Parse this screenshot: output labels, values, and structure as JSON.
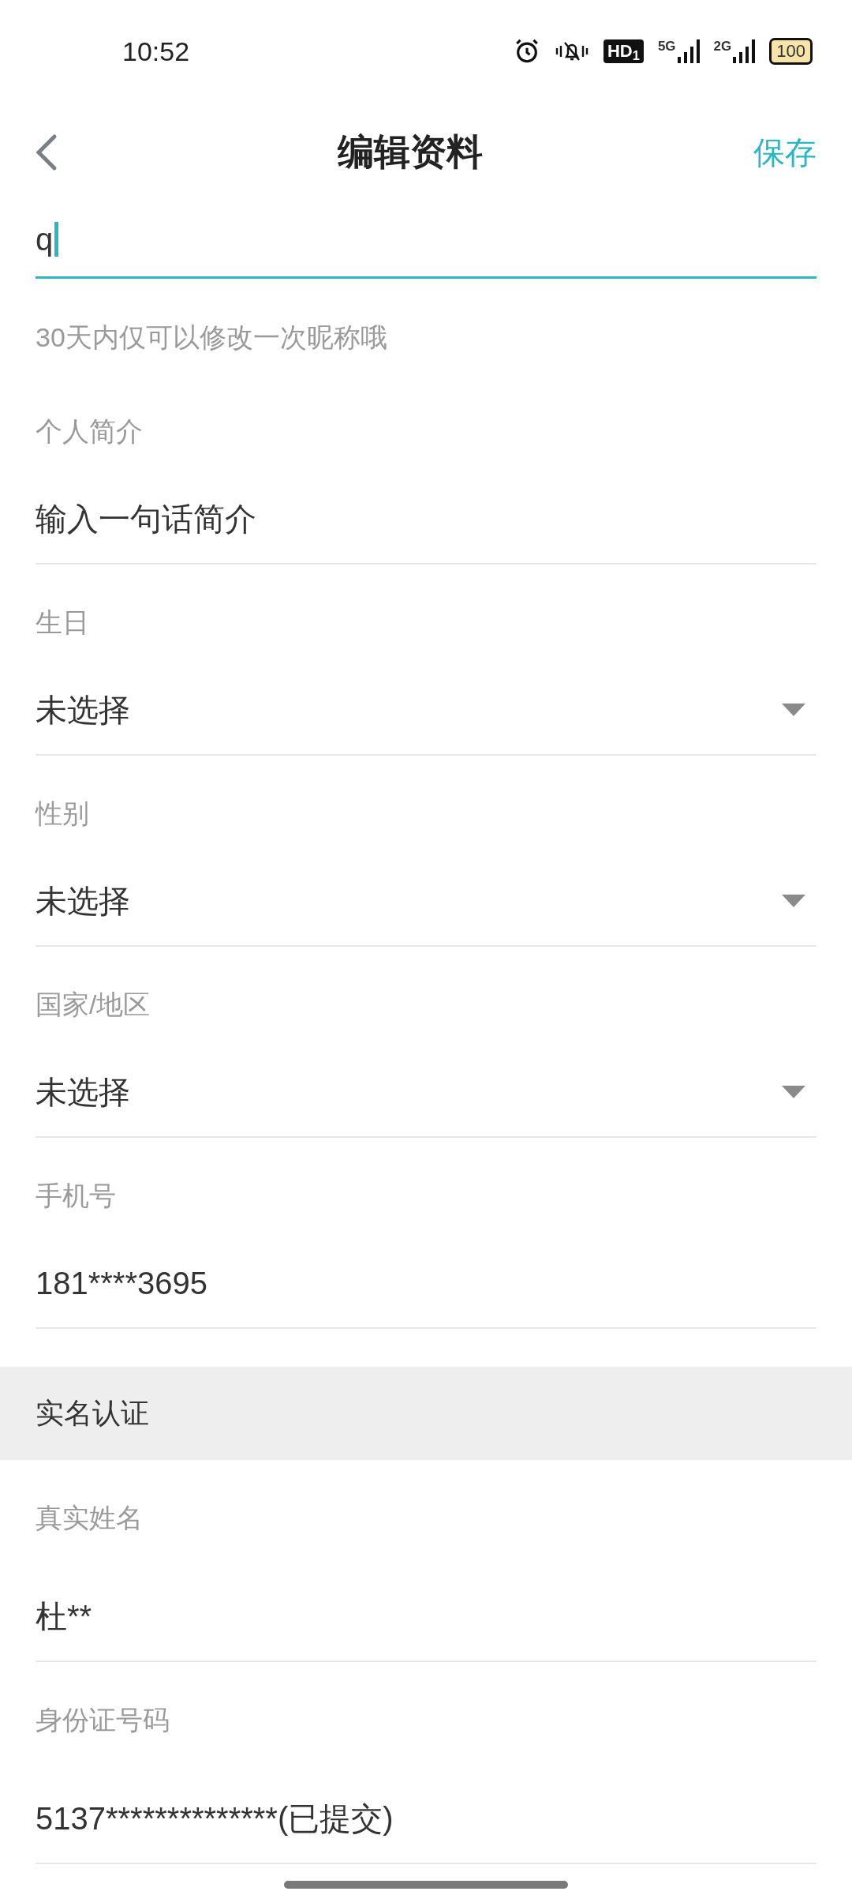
{
  "status_bar": {
    "time": "10:52",
    "hd_badge": "HD$_{1}$",
    "sim1_network": "5G",
    "sim2_network": "2G",
    "battery": "100"
  },
  "header": {
    "title": "编辑资料",
    "action": "保存"
  },
  "nickname": {
    "value": "q",
    "focused": true,
    "hint": "30天内仅可以修改一次昵称哦"
  },
  "fields": [
    {
      "kind": "text",
      "label": "个人简介",
      "placeholder": "输入一句话简介"
    },
    {
      "kind": "select",
      "label": "生日",
      "value": "未选择"
    },
    {
      "kind": "select",
      "label": "性别",
      "value": "未选择"
    },
    {
      "kind": "select",
      "label": "国家/地区",
      "value": "未选择"
    },
    {
      "kind": "text",
      "label": "手机号",
      "value": "181****3695"
    }
  ],
  "real_name_section": {
    "title": "实名认证",
    "fields": [
      {
        "kind": "text",
        "label": "真实姓名",
        "value": "杜**"
      },
      {
        "kind": "text",
        "label": "身份证号码",
        "value": "5137**************(已提交)"
      }
    ]
  }
}
